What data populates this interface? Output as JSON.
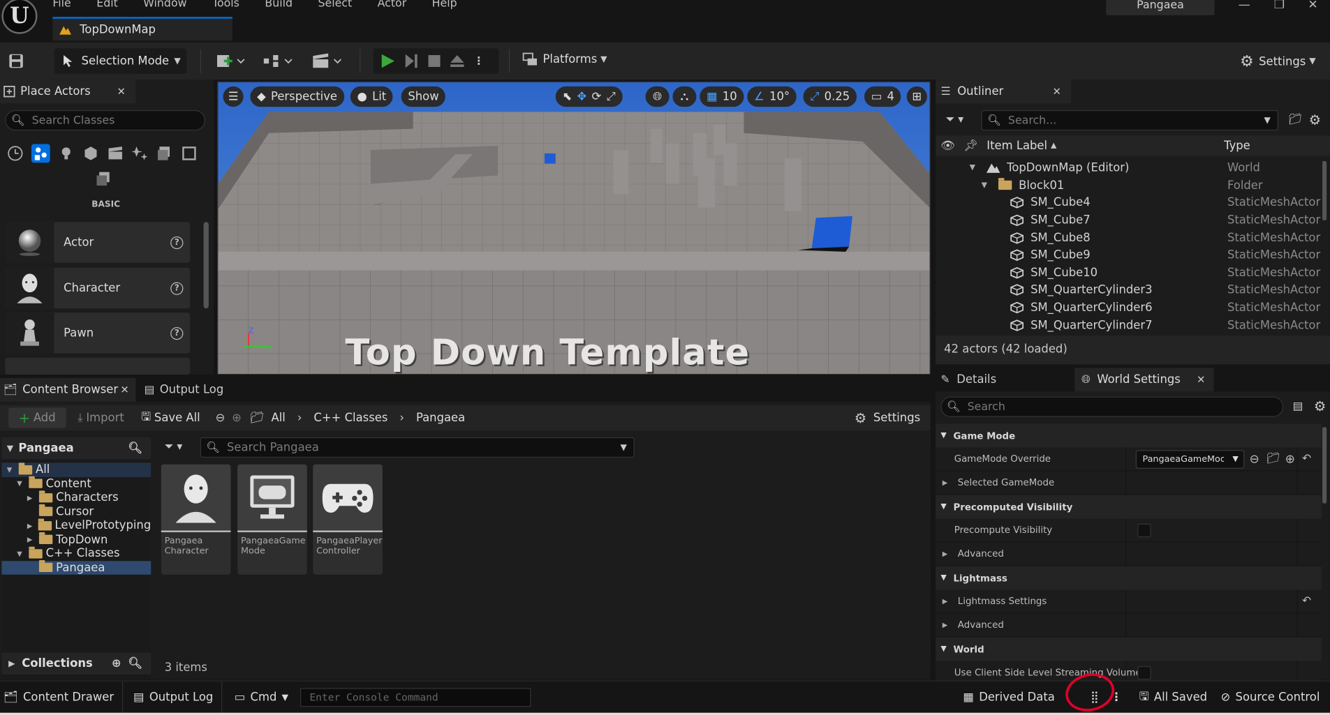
{
  "app": {
    "menu": [
      "File",
      "Edit",
      "Window",
      "Tools",
      "Build",
      "Select",
      "Actor",
      "Help"
    ],
    "map_tab": "TopDownMap",
    "project": "Pangaea",
    "logo": "U"
  },
  "toolbar": {
    "selection_mode": "Selection Mode",
    "platforms": "Platforms",
    "settings": "Settings"
  },
  "place_actors": {
    "title": "Place Actors",
    "search_placeholder": "Search Classes",
    "category": "BASIC",
    "items": [
      {
        "label": "Actor",
        "icon": "sphere-icon"
      },
      {
        "label": "Character",
        "icon": "character-icon"
      },
      {
        "label": "Pawn",
        "icon": "pawn-icon"
      }
    ]
  },
  "viewport": {
    "perspective": "Perspective",
    "lit": "Lit",
    "show": "Show",
    "grid": "10",
    "angle": "10°",
    "scale": "0.25",
    "camera_speed": "4",
    "overlay_text": "Top Down Template"
  },
  "outliner": {
    "title": "Outliner",
    "search_placeholder": "Search...",
    "col_label": "Item Label",
    "col_type": "Type",
    "rows": [
      {
        "label": "TopDownMap (Editor)",
        "type": "World",
        "indent": 0,
        "kind": "world"
      },
      {
        "label": "Block01",
        "type": "Folder",
        "indent": 1,
        "kind": "folder"
      },
      {
        "label": "SM_Cube4",
        "type": "StaticMeshActor",
        "indent": 2,
        "kind": "mesh"
      },
      {
        "label": "SM_Cube7",
        "type": "StaticMeshActor",
        "indent": 2,
        "kind": "mesh"
      },
      {
        "label": "SM_Cube8",
        "type": "StaticMeshActor",
        "indent": 2,
        "kind": "mesh"
      },
      {
        "label": "SM_Cube9",
        "type": "StaticMeshActor",
        "indent": 2,
        "kind": "mesh"
      },
      {
        "label": "SM_Cube10",
        "type": "StaticMeshActor",
        "indent": 2,
        "kind": "mesh"
      },
      {
        "label": "SM_QuarterCylinder3",
        "type": "StaticMeshActor",
        "indent": 2,
        "kind": "mesh"
      },
      {
        "label": "SM_QuarterCylinder6",
        "type": "StaticMeshActor",
        "indent": 2,
        "kind": "mesh"
      },
      {
        "label": "SM_QuarterCylinder7",
        "type": "StaticMeshActor",
        "indent": 2,
        "kind": "mesh"
      }
    ],
    "footer": "42 actors (42 loaded)"
  },
  "details": {
    "tab_details": "Details",
    "tab_world": "World Settings",
    "search_placeholder": "Search",
    "rows": [
      {
        "label": "Game Mode",
        "kind": "cat"
      },
      {
        "label": "GameMode Override",
        "kind": "select",
        "value": "PangaeaGameMode"
      },
      {
        "label": "Selected GameMode",
        "kind": "sub"
      },
      {
        "label": "Precomputed Visibility",
        "kind": "cat"
      },
      {
        "label": "Precompute Visibility",
        "kind": "check"
      },
      {
        "label": "Advanced",
        "kind": "sub"
      },
      {
        "label": "Lightmass",
        "kind": "cat"
      },
      {
        "label": "Lightmass Settings",
        "kind": "subreset"
      },
      {
        "label": "Advanced",
        "kind": "sub"
      },
      {
        "label": "World",
        "kind": "cat"
      },
      {
        "label": "Use Client Side Level Streaming Volumes",
        "kind": "check"
      }
    ]
  },
  "content_browser": {
    "tab": "Content Browser",
    "tab2": "Output Log",
    "add": "Add",
    "import": "Import",
    "save_all": "Save All",
    "breadcrumb": [
      "All",
      "C++ Classes",
      "Pangaea"
    ],
    "settings": "Settings",
    "source_title": "Pangaea",
    "search_placeholder": "Search Pangaea",
    "tree": [
      {
        "label": "All",
        "indent": 0,
        "open": true
      },
      {
        "label": "Content",
        "indent": 1,
        "open": true
      },
      {
        "label": "Characters",
        "indent": 2,
        "open": false
      },
      {
        "label": "Cursor",
        "indent": 2,
        "open": null
      },
      {
        "label": "LevelPrototyping",
        "indent": 2,
        "open": false
      },
      {
        "label": "TopDown",
        "indent": 2,
        "open": false
      },
      {
        "label": "C++ Classes",
        "indent": 1,
        "open": true
      },
      {
        "label": "Pangaea",
        "indent": 2,
        "open": null
      }
    ],
    "assets": [
      {
        "label": "Pangaea Character",
        "icon": "character-icon"
      },
      {
        "label": "PangaeaGame Mode",
        "icon": "game-mode-icon"
      },
      {
        "label": "PangaeaPlayer Controller",
        "icon": "gamepad-icon"
      }
    ],
    "collections": "Collections",
    "count": "3 items"
  },
  "statusbar": {
    "content_drawer": "Content Drawer",
    "output_log": "Output Log",
    "cmd": "Cmd",
    "console_placeholder": "Enter Console Command",
    "derived_data": "Derived Data",
    "all_saved": "All Saved",
    "source_control": "Source Control"
  }
}
